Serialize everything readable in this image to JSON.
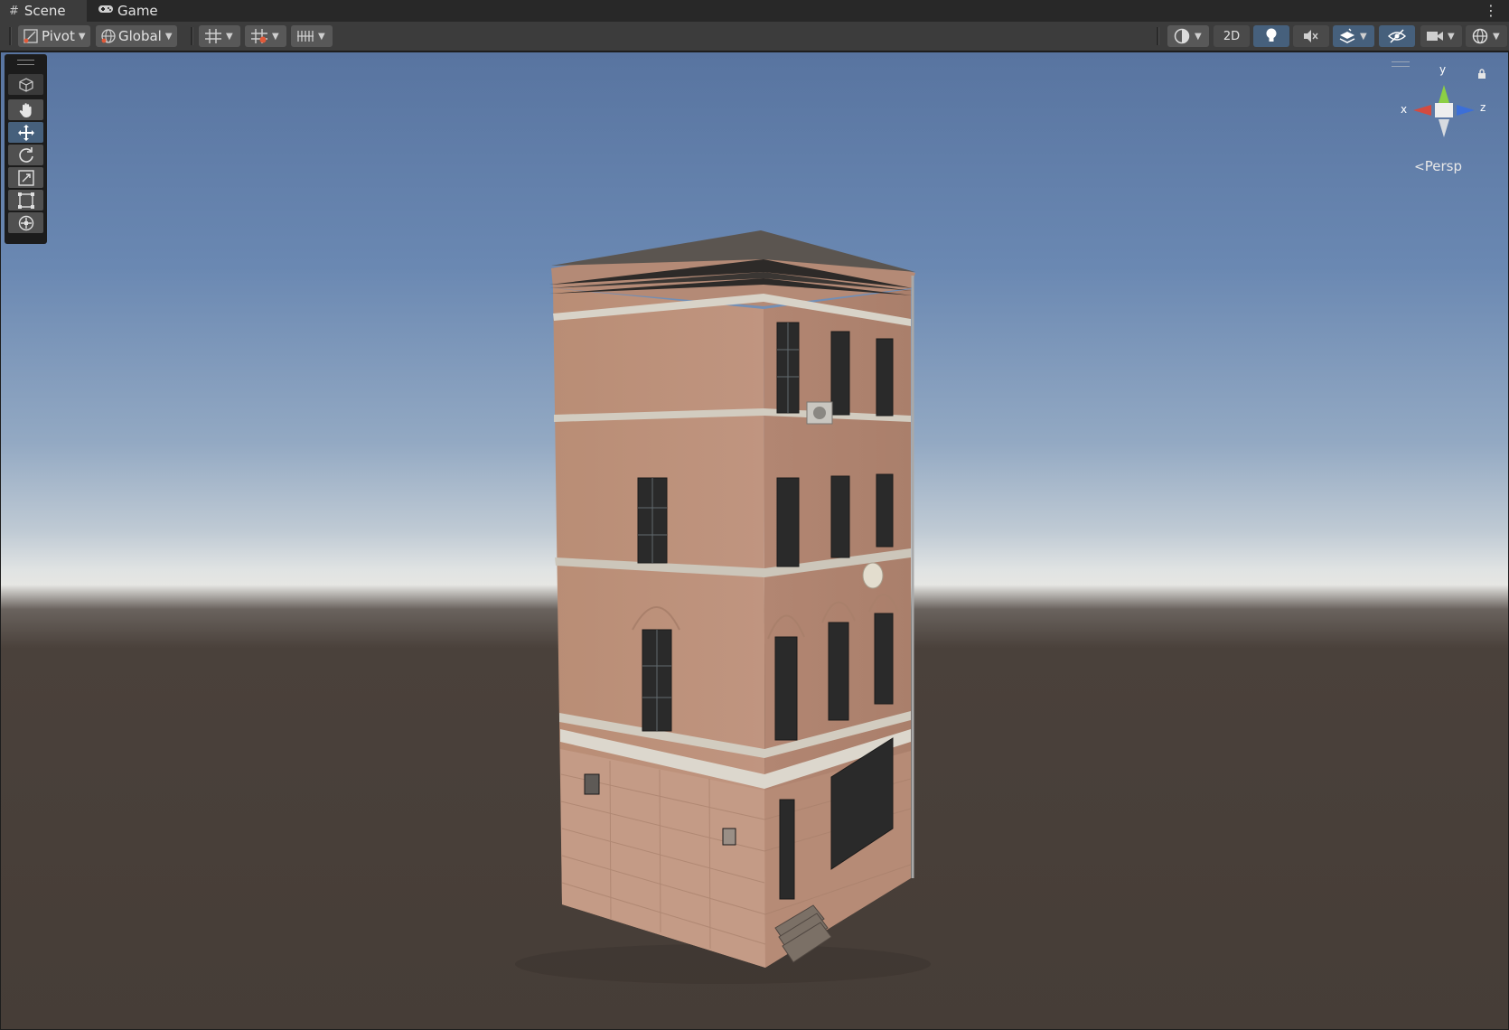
{
  "tabs": [
    {
      "label": "Scene",
      "icon": "scene-grid-icon"
    },
    {
      "label": "Game",
      "icon": "gamepad-icon"
    }
  ],
  "toolbar": {
    "pivot_label": "Pivot",
    "global_label": "Global",
    "twod_label": "2D"
  },
  "tools": [
    "view-cube-icon",
    "hand-tool-icon",
    "move-tool-icon",
    "rotate-tool-icon",
    "scale-tool-icon",
    "rect-tool-icon",
    "transform-tool-icon"
  ],
  "gizmo": {
    "x_label": "x",
    "y_label": "y",
    "z_label": "z",
    "projection_label": "Persp"
  },
  "colors": {
    "accent": "#46607c",
    "axis_x": "#d34b40",
    "axis_y": "#8ccf44",
    "axis_z": "#3c6fd8"
  }
}
